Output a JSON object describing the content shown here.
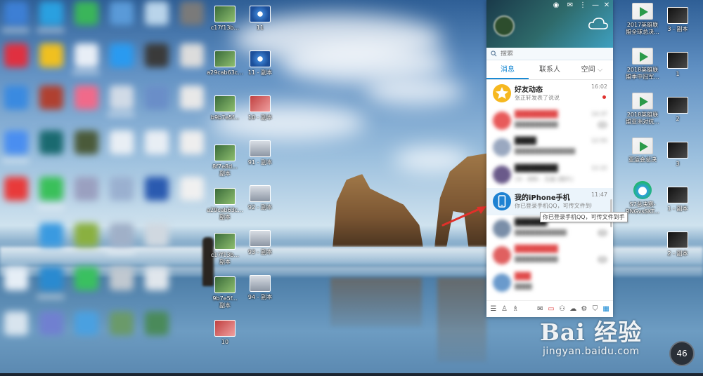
{
  "desktop": {
    "column_a": [
      {
        "label": "c17f13b...",
        "icon": "gpu-card-image"
      },
      {
        "label": "a29cab63c...",
        "icon": "gpu-card-image"
      },
      {
        "label": "b9b7e5f...",
        "icon": "gpu-card-image"
      },
      {
        "label": "8f7e8d...\n副本",
        "icon": "gpu-card-image"
      },
      {
        "label": "a29cab63c...\n副本",
        "icon": "gpu-card-image"
      },
      {
        "label": "c17f13b...\n副本",
        "icon": "gpu-card-image"
      },
      {
        "label": "9b7e5f...\n副本",
        "icon": "gpu-card-image"
      },
      {
        "label": "10",
        "icon": "red-card-image"
      }
    ],
    "column_b": [
      {
        "label": "11",
        "icon": "fan-image"
      },
      {
        "label": "11 - 副本",
        "icon": "fan-image"
      },
      {
        "label": "10 - 副本",
        "icon": "red-card-image"
      },
      {
        "label": "91 - 副本",
        "icon": "pc-image"
      },
      {
        "label": "92 - 副本",
        "icon": "pc-image"
      },
      {
        "label": "93 - 副本",
        "icon": "pc-image"
      },
      {
        "label": "94 - 副本",
        "icon": "pc-image"
      }
    ],
    "column_c": [
      {
        "label": "2017英雄联\n盟全球总决...",
        "icon": "video-file-icon"
      },
      {
        "label": "2018英雄联\n盟季中冠军...",
        "icon": "video-file-icon"
      },
      {
        "label": "2018英雄联\n盟亚洲对抗...",
        "icon": "video-file-icon"
      },
      {
        "label": "亚运会总决",
        "icon": "video-file-icon"
      },
      {
        "label": "S7总决赛-\nRNGvsSKT...",
        "icon": "movie-player-icon"
      }
    ],
    "column_d": [
      {
        "label": "3 - 副本",
        "icon": "dark-image"
      },
      {
        "label": "1",
        "icon": "dark-image"
      },
      {
        "label": "2",
        "icon": "dark-image"
      },
      {
        "label": "3",
        "icon": "dark-image"
      },
      {
        "label": "1 - 副本",
        "icon": "dark-image"
      },
      {
        "label": "2 - 副本",
        "icon": "dark-image"
      }
    ]
  },
  "qq": {
    "search_placeholder": "搜索",
    "tabs": [
      "消息",
      "联系人",
      "空间"
    ],
    "rows": [
      {
        "name": "好友动态",
        "msg": "张正轩发表了说说",
        "time": "16:02",
        "avatar_color": "#f6b820",
        "icon": "star-icon",
        "unread_dot": true
      },
      {
        "name": "████████",
        "msg": "██████████",
        "time": "14:37",
        "avatar_color": "#e85a5a",
        "count": "12",
        "blurred": true
      },
      {
        "name": "████",
        "msg": "██████████████",
        "time": "12:55",
        "avatar_color": "#9aa8c0",
        "blurred": true
      },
      {
        "name": "████████",
        "msg": "19 - 材料 - 王超 [图片]",
        "time": "12:22",
        "avatar_color": "#6a5a8a",
        "blurred": true
      },
      {
        "name": "我的iPhone手机",
        "msg": "你已登录手机QQ，可传文件到手",
        "time": "11:47",
        "avatar_color": "#1e82d2",
        "icon": "phone-icon"
      },
      {
        "name": "██████",
        "msg": "████████████",
        "time": "",
        "avatar_color": "#7a8ea8",
        "count": "3",
        "blurred": true
      },
      {
        "name": "████████",
        "msg": "██████████",
        "time": "",
        "avatar_color": "#e06060",
        "count": "5",
        "blurred": true
      },
      {
        "name": "███",
        "msg": "████",
        "time": "",
        "avatar_color": "#6a9acc",
        "blurred": true
      }
    ],
    "tooltip": "你已登录手机QQ，可传文件到手"
  },
  "watermark": {
    "brand": "Bai 经验",
    "url": "jingyan.baidu.com"
  },
  "badge": "46"
}
